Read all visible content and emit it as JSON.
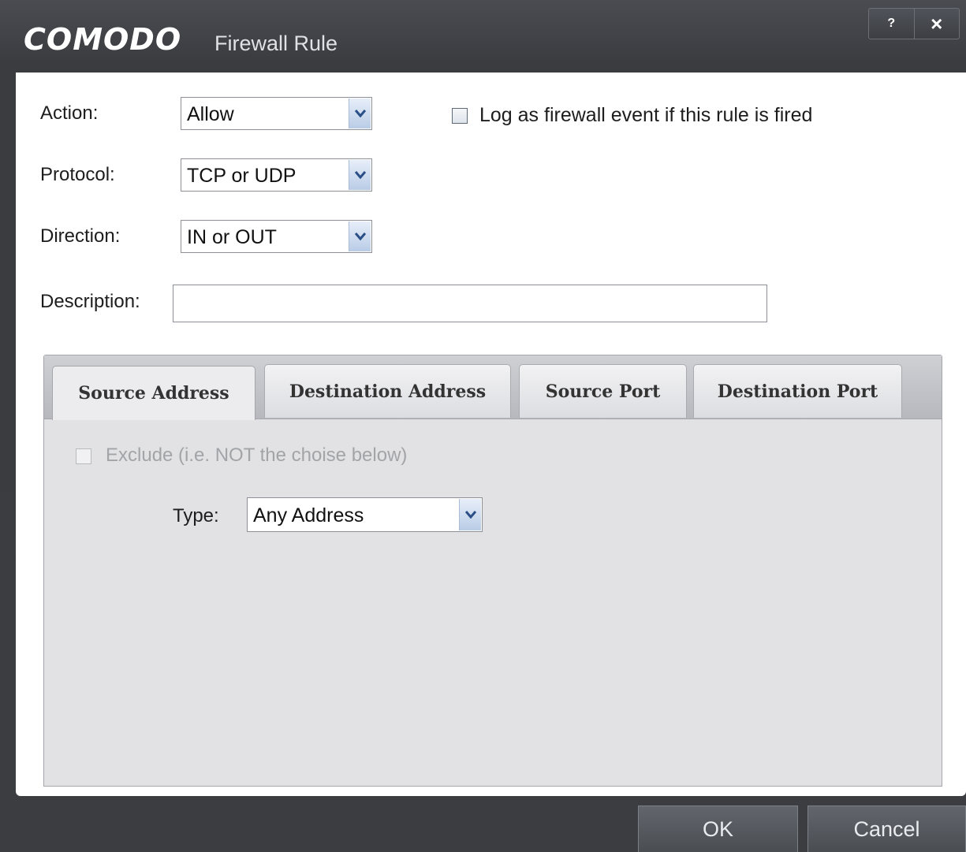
{
  "window": {
    "brand": "COMODO",
    "title": "Firewall Rule",
    "help_label": "?",
    "close_label": "×"
  },
  "form": {
    "action": {
      "label": "Action:",
      "value": "Allow"
    },
    "log_event": {
      "label": "Log as firewall event if this rule is fired",
      "checked": false
    },
    "protocol": {
      "label": "Protocol:",
      "value": "TCP or UDP"
    },
    "direction": {
      "label": "Direction:",
      "value": "IN or OUT"
    },
    "description": {
      "label": "Description:",
      "value": ""
    }
  },
  "tabs": [
    {
      "label": "Source Address",
      "active": true
    },
    {
      "label": "Destination Address",
      "active": false
    },
    {
      "label": "Source Port",
      "active": false
    },
    {
      "label": "Destination Port",
      "active": false
    }
  ],
  "source_address": {
    "exclude_label": "Exclude (i.e. NOT the choise below)",
    "exclude_checked": false,
    "exclude_enabled": false,
    "type_label": "Type:",
    "type_value": "Any Address"
  },
  "buttons": {
    "ok": "OK",
    "cancel": "Cancel"
  },
  "colors": {
    "titlebar": "#3f4146",
    "panel": "#e2e2e5",
    "dropdown_arrow": "#b9cce6"
  }
}
